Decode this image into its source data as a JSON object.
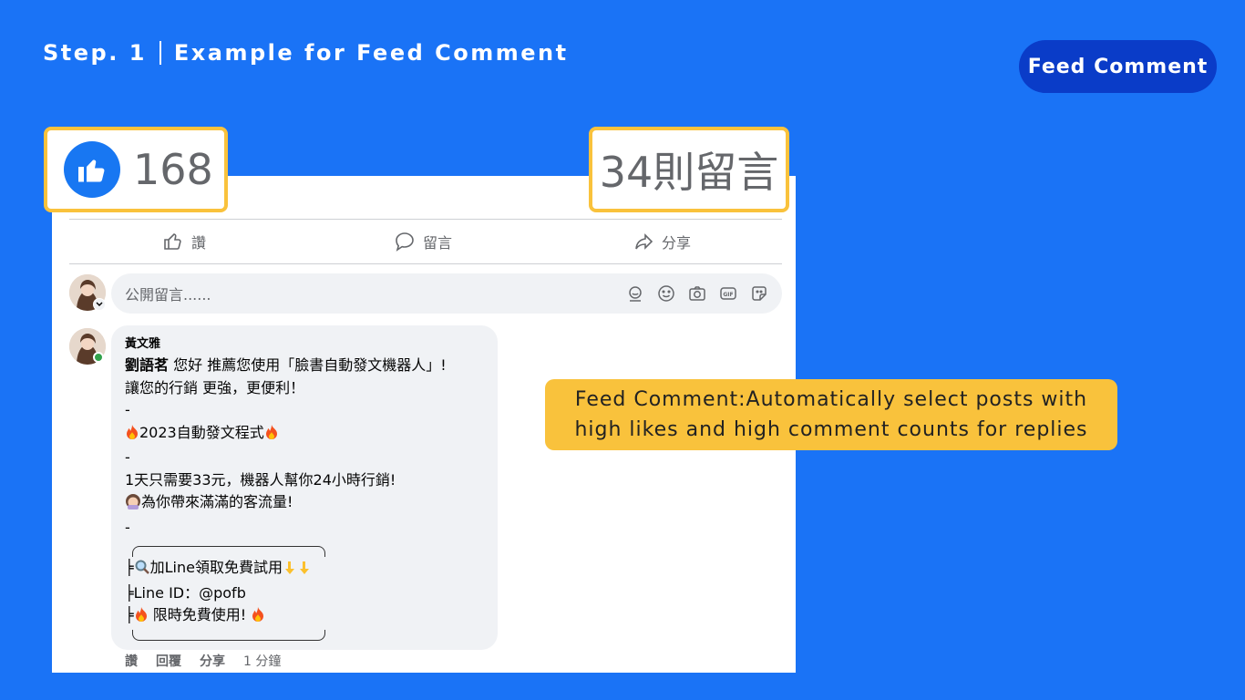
{
  "header": {
    "step": "Step. 1",
    "title": "Example for Feed Comment",
    "badge": "Feed Comment"
  },
  "post": {
    "likes_count": "168",
    "comments_count": "34則留言",
    "actions": [
      "讚",
      "留言",
      "分享"
    ],
    "composer_placeholder": "公開留言......"
  },
  "comment": {
    "author": "黃文雅",
    "mention": "劉語茗",
    "lines": [
      " 您好 推薦您使用「臉書自動發文機器人」!",
      "讓您的行銷 更強，更便利！",
      "-",
      "2023自動發文程式",
      "-",
      "1天只需要33元，機器人幫你24小時行銷!",
      "為你帶來滿滿的客流量!",
      "-",
      "加Line領取免費試用",
      "Line ID：@pofb",
      "限時免費使用!"
    ],
    "meta": [
      "讚",
      "回覆",
      "分享",
      "1 分鐘"
    ]
  },
  "callout": {
    "text": "Feed Comment:Automatically select posts with high likes and high comment counts for replies"
  },
  "colors": {
    "background": "#1a73f6",
    "badge": "#0a3cc8",
    "highlight": "#f9c23c",
    "fb_blue": "#1877f2"
  }
}
